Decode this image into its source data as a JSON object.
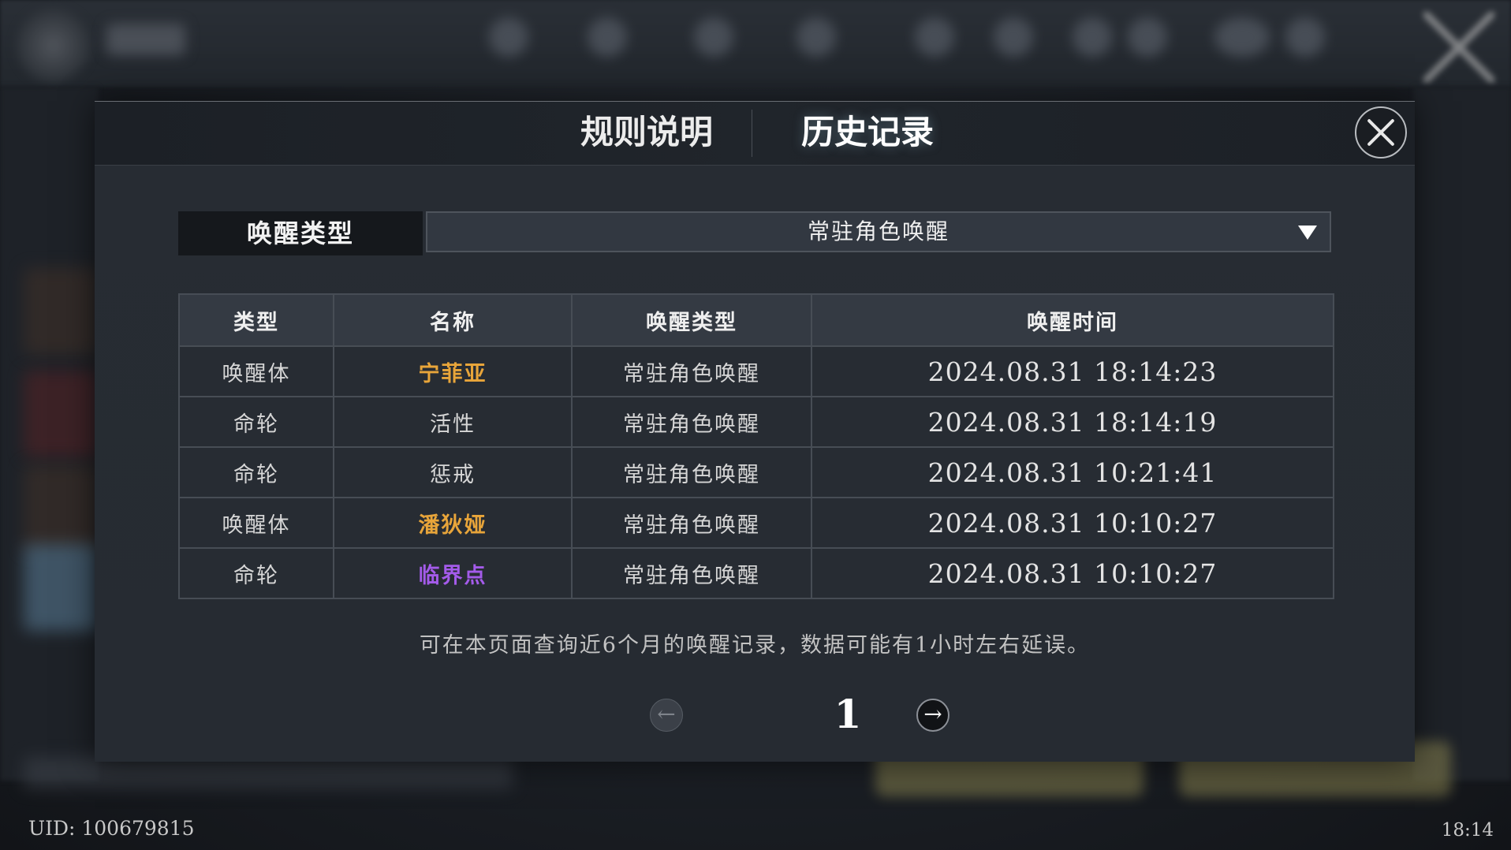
{
  "tabs": {
    "rules": "规则说明",
    "history": "历史记录"
  },
  "filter": {
    "label": "唤醒类型",
    "selected": "常驻角色唤醒"
  },
  "table": {
    "headers": [
      "类型",
      "名称",
      "唤醒类型",
      "唤醒时间"
    ],
    "rows": [
      {
        "type": "唤醒体",
        "name": "宁菲亚",
        "name_color": "#e8a53a",
        "wake_type": "常驻角色唤醒",
        "time": "2024.08.31 18:14:23"
      },
      {
        "type": "命轮",
        "name": "活性",
        "name_color": "#d6d6d6",
        "wake_type": "常驻角色唤醒",
        "time": "2024.08.31 18:14:19"
      },
      {
        "type": "命轮",
        "name": "惩戒",
        "name_color": "#d6d6d6",
        "wake_type": "常驻角色唤醒",
        "time": "2024.08.31 10:21:41"
      },
      {
        "type": "唤醒体",
        "name": "潘狄娅",
        "name_color": "#e8a53a",
        "wake_type": "常驻角色唤醒",
        "time": "2024.08.31 10:10:27"
      },
      {
        "type": "命轮",
        "name": "临界点",
        "name_color": "#a45bea",
        "wake_type": "常驻角色唤醒",
        "time": "2024.08.31 10:10:27"
      }
    ]
  },
  "note": "可在本页面查询近6个月的唤醒记录，数据可能有1小时左右延误。",
  "pagination": {
    "page": "1",
    "prev_icon": "←",
    "next_icon": "→"
  },
  "footer": {
    "uid": "UID: 100679815",
    "clock": "18:14"
  },
  "icons": {
    "close": "close-icon",
    "dropdown": "chevron-down-icon",
    "prev": "arrow-left-icon",
    "next": "arrow-right-icon"
  }
}
